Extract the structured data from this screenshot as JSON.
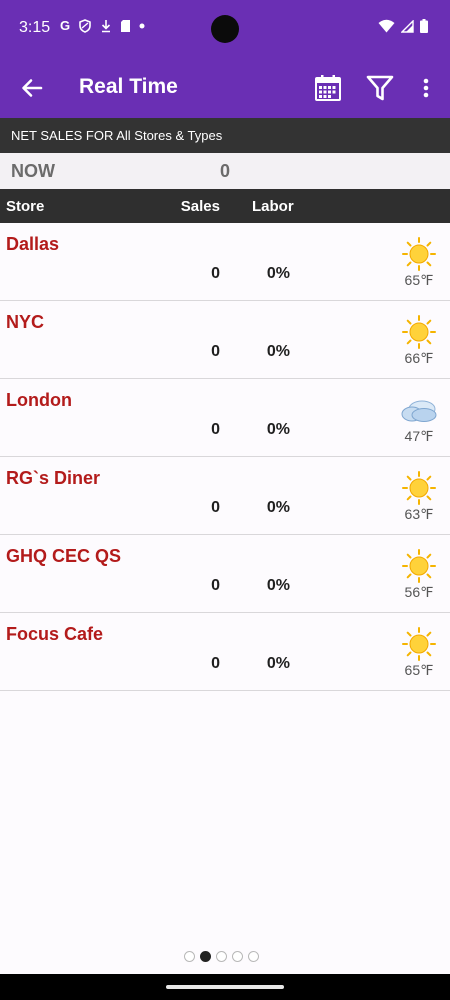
{
  "status_bar": {
    "time": "3:15",
    "left_icons": [
      "google-icon",
      "shield-icon",
      "download-icon",
      "sd-card-icon",
      "dot-icon"
    ],
    "right_icons": [
      "wifi-icon",
      "signal-icon",
      "battery-icon"
    ]
  },
  "app_bar": {
    "title": "Real Time",
    "back_icon": "arrow-left-icon",
    "actions": [
      "calendar-icon",
      "filter-icon",
      "more-vert-icon"
    ],
    "color": "#6a2fb4"
  },
  "summary": {
    "header": "NET SALES FOR All Stores & Types",
    "now_label": "NOW",
    "now_value": "0"
  },
  "table": {
    "columns": {
      "store": "Store",
      "sales": "Sales",
      "labor": "Labor"
    },
    "rows": [
      {
        "name": "Dallas",
        "sales": "0",
        "labor": "0%",
        "weather": "sunny",
        "temp": "65℉"
      },
      {
        "name": "NYC",
        "sales": "0",
        "labor": "0%",
        "weather": "sunny",
        "temp": "66℉"
      },
      {
        "name": "London",
        "sales": "0",
        "labor": "0%",
        "weather": "cloudy",
        "temp": "47℉"
      },
      {
        "name": "RG`s Diner",
        "sales": "0",
        "labor": "0%",
        "weather": "sunny",
        "temp": "63℉"
      },
      {
        "name": "GHQ CEC QS",
        "sales": "0",
        "labor": "0%",
        "weather": "sunny",
        "temp": "56℉"
      },
      {
        "name": "Focus Cafe",
        "sales": "0",
        "labor": "0%",
        "weather": "sunny",
        "temp": "65℉"
      }
    ]
  },
  "pager": {
    "count": 5,
    "active_index": 1
  },
  "colors": {
    "store_name": "#b31b1b",
    "header_dark": "#333333"
  }
}
